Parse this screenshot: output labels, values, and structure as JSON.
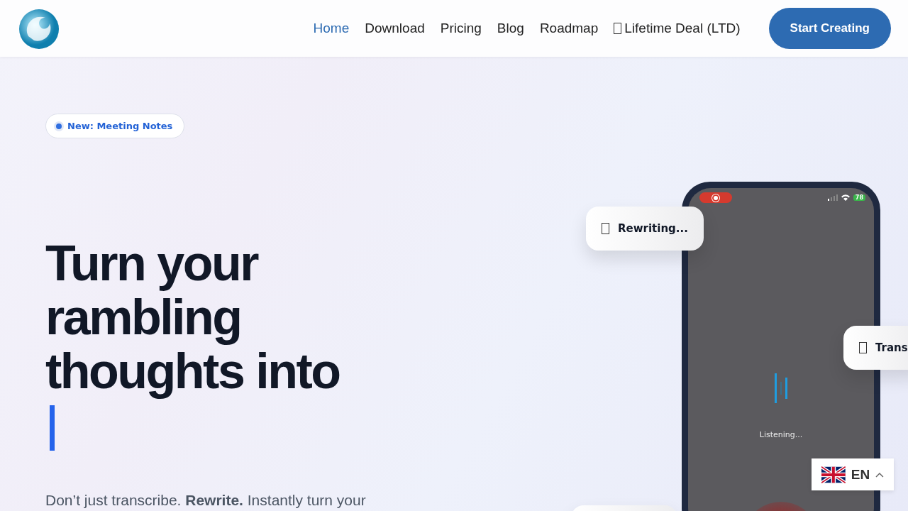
{
  "nav": {
    "links": [
      {
        "label": "Home",
        "selected": true
      },
      {
        "label": "Download",
        "selected": false
      },
      {
        "label": "Pricing",
        "selected": false
      },
      {
        "label": "Blog",
        "selected": false
      },
      {
        "label": "Roadmap",
        "selected": false
      },
      {
        "label": "Lifetime Deal (LTD)",
        "selected": false,
        "kind": "icon"
      }
    ],
    "cta": "Start Creating"
  },
  "hero": {
    "badge": "New: Meeting Notes",
    "heading": "Turn your rambling thoughts into",
    "subtitle": "Don’t just transcribe. **Rewrite.** Instantly turn your"
  },
  "phone": {
    "battery": "78",
    "status": "Listening..."
  },
  "floating_cards": [
    {
      "label": "Rewriting..."
    },
    {
      "label": "Trans"
    }
  ],
  "language": {
    "code": "EN"
  }
}
